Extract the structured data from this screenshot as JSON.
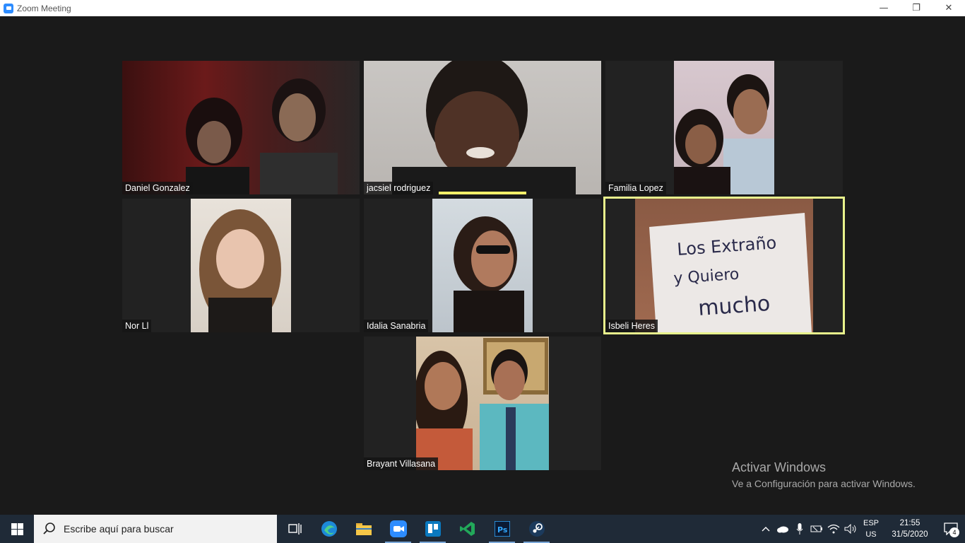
{
  "window": {
    "title": "Zoom Meeting",
    "controls": {
      "minimize": "—",
      "restore": "❐",
      "close": "✕"
    }
  },
  "participants": [
    {
      "name": "Daniel Gonzalez",
      "speaking": false,
      "active": false
    },
    {
      "name": "jacsiel rodriguez",
      "speaking": true,
      "active": false
    },
    {
      "name": "Familia Lopez",
      "speaking": false,
      "active": false
    },
    {
      "name": "Nor Ll",
      "speaking": false,
      "active": false
    },
    {
      "name": "Idalia Sanabria",
      "speaking": false,
      "active": false
    },
    {
      "name": "Isbeli Heres",
      "speaking": false,
      "active": true
    },
    {
      "name": "Brayant Villasana",
      "speaking": false,
      "active": false
    }
  ],
  "sign_text": [
    "Los Extraño",
    "y Quiero",
    "mucho"
  ],
  "watermark": {
    "line1": "Activar Windows",
    "line2": "Ve a Configuración para activar Windows."
  },
  "taskbar": {
    "search_placeholder": "Escribe aquí para buscar",
    "apps": [
      "task-view",
      "edge",
      "file-explorer",
      "zoom",
      "trello",
      "vscode",
      "photoshop",
      "steam"
    ],
    "language": {
      "line1": "ESP",
      "line2": "US"
    },
    "time": "21:55",
    "date": "31/5/2020",
    "notification_count": "4"
  },
  "colors": {
    "meeting_bg": "#1a1a1a",
    "tile_bg": "#222222",
    "active_border": "#e8f28c",
    "speaking_bar": "#f4f16a",
    "taskbar": "#1f2a37",
    "zoom_blue": "#2d8cff"
  }
}
